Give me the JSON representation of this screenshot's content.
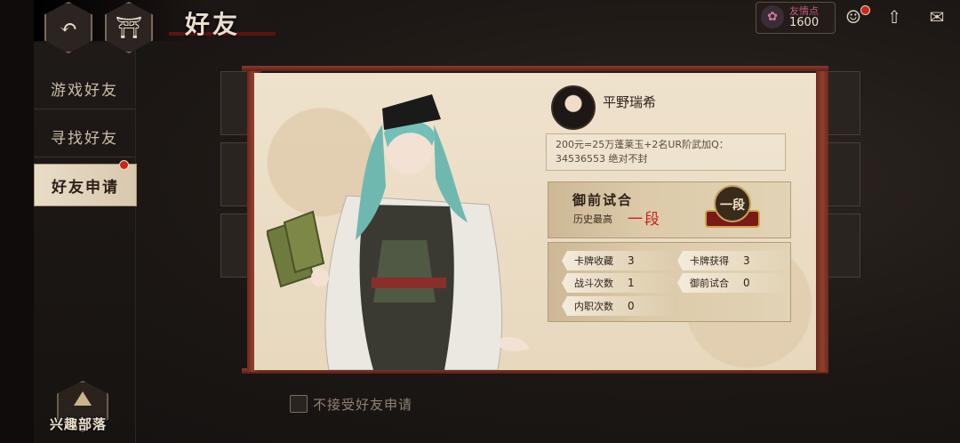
{
  "header": {
    "title": "好友",
    "back_icon": "back-arrow-icon",
    "home_icon": "pavilion-icon"
  },
  "resource": {
    "label": "友情点",
    "value": "1600"
  },
  "top_icons": [
    "character-icon",
    "upgrade-arrow-icon",
    "mail-icon"
  ],
  "sidebar": {
    "items": [
      {
        "label": "游戏好友"
      },
      {
        "label": "寻找好友"
      },
      {
        "label": "好友申请"
      }
    ]
  },
  "profile": {
    "name": "平野瑞希",
    "signature": "200元=25万蓬莱玉+2名UR阶武加Q：34536553 绝对不封",
    "trial": {
      "title": "御前试合",
      "history_label": "历史最高",
      "rank": "一段",
      "badge_text": "一段"
    },
    "stats": [
      {
        "label": "卡牌收藏",
        "value": "3"
      },
      {
        "label": "卡牌获得",
        "value": "3"
      },
      {
        "label": "战斗次数",
        "value": "1"
      },
      {
        "label": "御前试合",
        "value": "0"
      },
      {
        "label": "内职次数",
        "value": "0"
      }
    ]
  },
  "footer": {
    "checkbox_label": "不接受好友申请",
    "tribe_label": "兴趣部落"
  },
  "colors": {
    "accent_red": "#c8241a",
    "paper": "#efe2cc",
    "scroll_wood": "#8a3b2a"
  }
}
